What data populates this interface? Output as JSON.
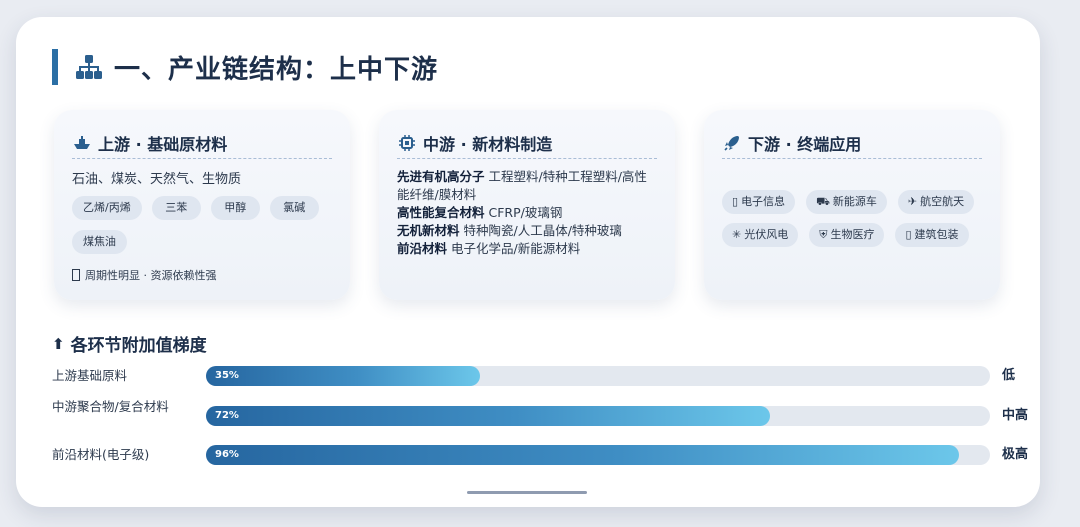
{
  "title": "一、产业链结构：上中下游",
  "upstream": {
    "title": "上游 · 基础原材料",
    "desc": "石油、煤炭、天然气、生物质",
    "pills": [
      "乙烯/丙烯",
      "三苯",
      "甲醇",
      "氯碱",
      "煤焦油"
    ],
    "note": "周期性明显 · 资源依赖性强"
  },
  "midstream": {
    "title": "中游 · 新材料制造",
    "lines": [
      {
        "bold": "先进有机高分子",
        "text": " 工程塑料/特种工程塑料/高性能纤维/膜材料"
      },
      {
        "bold": "高性能复合材料",
        "text": " CFRP/玻璃钢"
      },
      {
        "bold": "无机新材料",
        "text": " 特种陶瓷/人工晶体/特种玻璃"
      },
      {
        "bold": "前沿材料",
        "text": " 电子化学品/新能源材料"
      }
    ]
  },
  "downstream": {
    "title": "下游 · 终端应用",
    "pills": [
      {
        "icon": "phone-icon",
        "glyph": "▯",
        "label": "电子信息"
      },
      {
        "icon": "car-icon",
        "glyph": "⛟",
        "label": "新能源车"
      },
      {
        "icon": "plane-icon",
        "glyph": "✈",
        "label": "航空航天"
      },
      {
        "icon": "solar-icon",
        "glyph": "✳",
        "label": "光伏风电"
      },
      {
        "icon": "shield-icon",
        "glyph": "⛨",
        "label": "生物医疗"
      },
      {
        "icon": "box-icon",
        "glyph": "▯",
        "label": "建筑包装"
      }
    ]
  },
  "gradient": {
    "title": "各环节附加值梯度",
    "rows": [
      {
        "label": "上游基础原料",
        "percent": 35,
        "percent_text": "35%",
        "level": "低"
      },
      {
        "label": "中游聚合物/复合材料",
        "percent": 72,
        "percent_text": "72%",
        "level": "中高"
      },
      {
        "label": "前沿材料(电子级)",
        "percent": 96,
        "percent_text": "96%",
        "level": "极高"
      }
    ]
  },
  "colors": {
    "accent": "#2b6fa5",
    "title": "#1d2f4a",
    "bar_start": "#2666a0",
    "bar_end": "#6cc7ea"
  }
}
